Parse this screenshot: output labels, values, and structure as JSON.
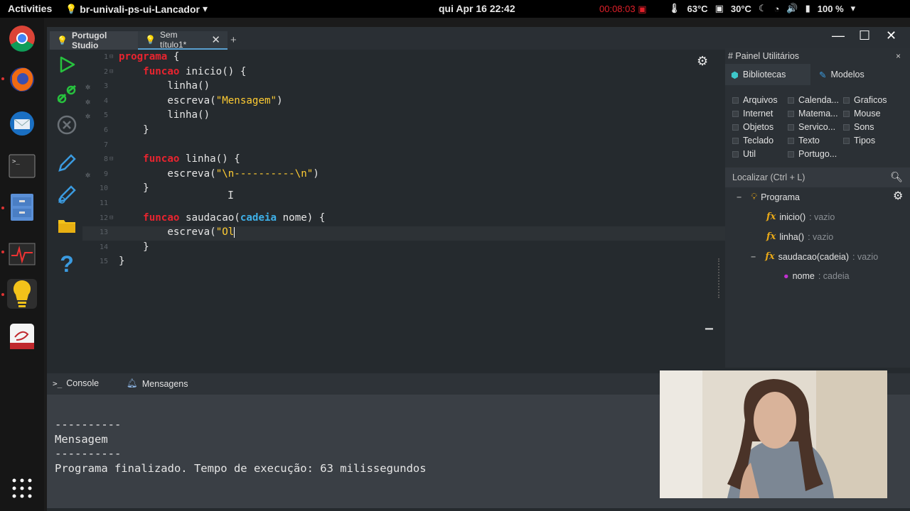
{
  "topbar": {
    "activities": "Activities",
    "app_menu": "br-univali-ps-ui-Lancador",
    "clock": "qui Apr 16  22:42",
    "recording": "00:08:03",
    "cpu_temp": "63°C",
    "gpu_temp": "30°C",
    "battery": "100 %"
  },
  "dock": {
    "items": [
      "chrome",
      "firefox",
      "thunderbird",
      "terminal",
      "files",
      "system-monitor",
      "portugol-studio",
      "other-app"
    ],
    "show_apps": "show-apps"
  },
  "window": {
    "tabs": [
      {
        "label": "Portugol Studio"
      },
      {
        "label": "Sem título1*"
      }
    ],
    "new_tab": "+"
  },
  "editor": {
    "lines": [
      {
        "n": "1"
      },
      {
        "n": "2"
      },
      {
        "n": "3"
      },
      {
        "n": "4"
      },
      {
        "n": "5"
      },
      {
        "n": "6"
      },
      {
        "n": "7"
      },
      {
        "n": "8"
      },
      {
        "n": "9"
      },
      {
        "n": "10"
      },
      {
        "n": "11"
      },
      {
        "n": "12"
      },
      {
        "n": "13"
      },
      {
        "n": "14"
      },
      {
        "n": "15"
      }
    ],
    "code": {
      "l1_kw": "programa",
      "l1_rest": " {",
      "l2_kw": "funcao",
      "l2_rest": " inicio() {",
      "l3": "linha()",
      "l4_a": "escreva(",
      "l4_str": "\"Mensagem\"",
      "l4_b": ")",
      "l5": "linha()",
      "l6": "}",
      "l8_kw": "funcao",
      "l8_rest": " linha() {",
      "l9_a": "escreva(",
      "l9_str": "\"\\n----------\\n\"",
      "l9_b": ")",
      "l10": "}",
      "l12_kw": "funcao",
      "l12_a": " saudacao(",
      "l12_ty": "cadeia",
      "l12_b": " nome) {",
      "l13_a": "escreva(",
      "l13_str": "\"Ol",
      "l14": "}",
      "l15": "}"
    }
  },
  "panel": {
    "title": "# Painel Utilitários",
    "close": "×",
    "tab_libs": "Bibliotecas",
    "tab_models": "Modelos",
    "libraries": [
      "Arquivos",
      "Calenda...",
      "Graficos",
      "Internet",
      "Matema...",
      "Mouse",
      "Objetos",
      "Servico...",
      "Sons",
      "Teclado",
      "Texto",
      "Tipos",
      "Util",
      "Portugo..."
    ],
    "search_placeholder": "Localizar (Ctrl + L)",
    "tree": {
      "root": "Programa",
      "items": [
        {
          "name": "inicio()",
          "type": " : vazio"
        },
        {
          "name": "linha()",
          "type": " : vazio"
        },
        {
          "name": "saudacao(cadeia)",
          "type": " : vazio"
        }
      ],
      "param": {
        "name": "nome",
        "type": " : cadeia"
      }
    }
  },
  "console": {
    "tab_console": "Console",
    "tab_messages": "Mensagens",
    "output": [
      "----------",
      "Mensagem",
      "----------",
      "",
      "Programa finalizado. Tempo de execução: 63 milissegundos"
    ]
  }
}
